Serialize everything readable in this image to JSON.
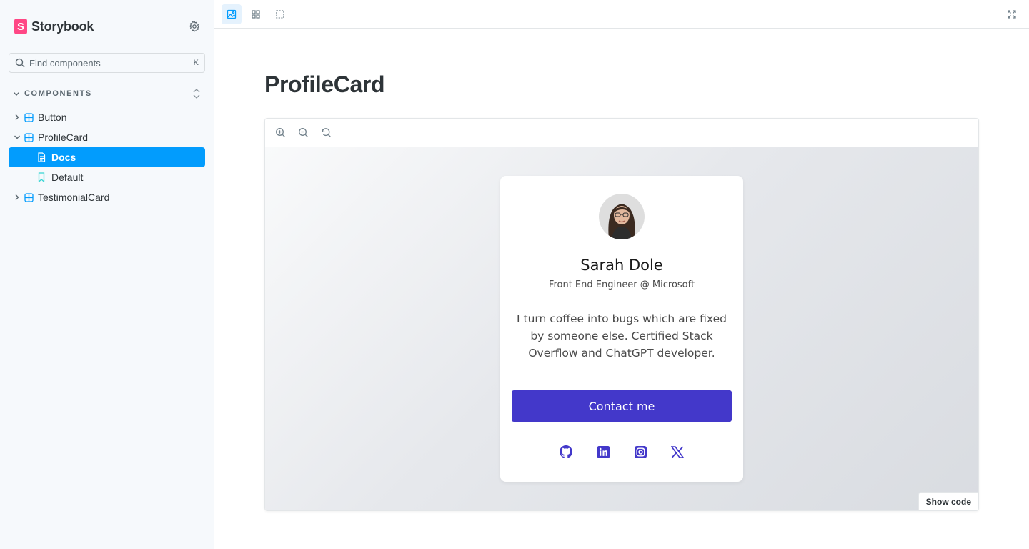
{
  "app": {
    "name": "Storybook",
    "logo_letter": "S",
    "accent_color": "#ff4785",
    "selection_color": "#029cfd"
  },
  "sidebar": {
    "search": {
      "placeholder": "Find components",
      "shortcut": "K"
    },
    "section_title": "COMPONENTS",
    "items": [
      {
        "label": "Button",
        "icon": "component-icon",
        "expanded": false
      },
      {
        "label": "ProfileCard",
        "icon": "component-icon",
        "expanded": true
      },
      {
        "label": "Docs",
        "icon": "document-icon",
        "selected": true
      },
      {
        "label": "Default",
        "icon": "bookmark-icon"
      },
      {
        "label": "TestimonialCard",
        "icon": "component-icon",
        "expanded": false
      }
    ]
  },
  "toolbar": {
    "buttons": [
      "image-icon",
      "grid-icon",
      "outline-icon"
    ],
    "fullscreen": "expand-icon"
  },
  "docs": {
    "title": "ProfileCard",
    "canvas_tools": [
      "zoom-in-icon",
      "zoom-out-icon",
      "zoom-reset-icon"
    ],
    "show_code_label": "Show code"
  },
  "profile_card": {
    "name": "Sarah Dole",
    "role": "Front End Engineer @ Microsoft",
    "bio": "I turn coffee into bugs which are fixed by someone else. Certified Stack Overflow and ChatGPT developer.",
    "button_label": "Contact me",
    "button_color": "#4338ca",
    "socials": [
      "github-icon",
      "linkedin-icon",
      "instagram-icon",
      "x-icon"
    ]
  }
}
